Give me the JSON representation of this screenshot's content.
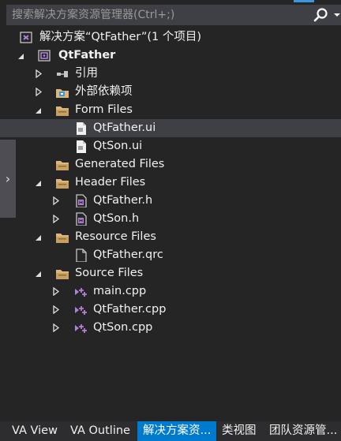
{
  "search": {
    "placeholder": "搜索解决方案资源管理器(Ctrl+;)"
  },
  "side_handle": {
    "glyph": "›"
  },
  "tree": [
    {
      "label": "解决方案“QtFather”(1 个项目)",
      "icon": "solution-icon",
      "expander": "none",
      "selected": false,
      "bold": false
    },
    {
      "label": "QtFather",
      "icon": "qt-project-icon",
      "expander": "expanded",
      "selected": false,
      "bold": true
    },
    {
      "label": "引用",
      "icon": "references-icon",
      "expander": "collapsed",
      "selected": false,
      "bold": false
    },
    {
      "label": "外部依赖项",
      "icon": "external-dependencies-icon",
      "expander": "collapsed",
      "selected": false,
      "bold": false
    },
    {
      "label": "Form Files",
      "icon": "folder-icon",
      "expander": "expanded",
      "selected": false,
      "bold": false
    },
    {
      "label": "QtFather.ui",
      "icon": "ui-file-icon",
      "expander": "none",
      "selected": true,
      "bold": false
    },
    {
      "label": "QtSon.ui",
      "icon": "ui-file-icon",
      "expander": "none",
      "selected": false,
      "bold": false
    },
    {
      "label": "Generated Files",
      "icon": "folder-icon",
      "expander": "none",
      "selected": false,
      "bold": false
    },
    {
      "label": "Header Files",
      "icon": "folder-icon",
      "expander": "expanded",
      "selected": false,
      "bold": false
    },
    {
      "label": "QtFather.h",
      "icon": "header-file-icon",
      "expander": "collapsed",
      "selected": false,
      "bold": false
    },
    {
      "label": "QtSon.h",
      "icon": "header-file-icon",
      "expander": "collapsed",
      "selected": false,
      "bold": false
    },
    {
      "label": "Resource Files",
      "icon": "folder-icon",
      "expander": "expanded",
      "selected": false,
      "bold": false
    },
    {
      "label": "QtFather.qrc",
      "icon": "file-icon",
      "expander": "none",
      "selected": false,
      "bold": false
    },
    {
      "label": "Source Files",
      "icon": "folder-icon",
      "expander": "expanded",
      "selected": false,
      "bold": false
    },
    {
      "label": "main.cpp",
      "icon": "cpp-file-icon",
      "expander": "collapsed",
      "selected": false,
      "bold": false
    },
    {
      "label": "QtFather.cpp",
      "icon": "cpp-file-icon",
      "expander": "collapsed",
      "selected": false,
      "bold": false
    },
    {
      "label": "QtSon.cpp",
      "icon": "cpp-file-icon",
      "expander": "collapsed",
      "selected": false,
      "bold": false
    }
  ],
  "bottom_tabs": [
    {
      "label": "VA View",
      "active": false
    },
    {
      "label": "VA Outline",
      "active": false
    },
    {
      "label": "解决方案资...",
      "active": true
    },
    {
      "label": "类视图",
      "active": false
    },
    {
      "label": "团队资源管...",
      "active": false
    }
  ],
  "colors": {
    "background": "#252526",
    "search_background": "#3f3f46",
    "selection": "#3f3f46",
    "active_tab": "#007acc",
    "accent": "#3a96dd",
    "folder": "#dcb67a",
    "qt_purple": "#b180d7",
    "text": "#f1f1f1"
  }
}
